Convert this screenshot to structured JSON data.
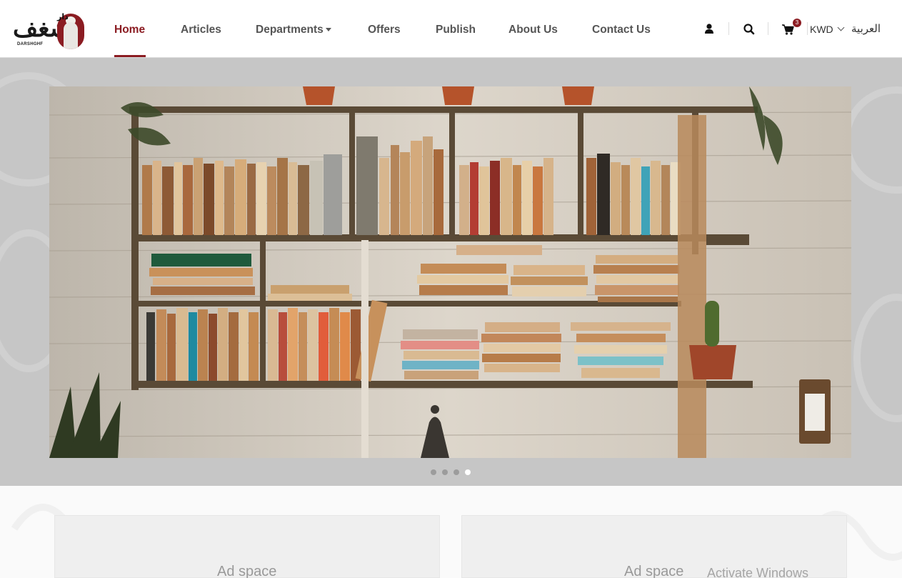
{
  "header": {
    "logo_text": "شغف",
    "logo_small_text": "دار",
    "logo_sub": "DARSHGHF"
  },
  "nav": {
    "items": [
      {
        "label": "Home",
        "active": true
      },
      {
        "label": "Articles"
      },
      {
        "label": "Departments",
        "has_dropdown": true
      },
      {
        "label": "Offers"
      },
      {
        "label": "Publish"
      },
      {
        "label": "About Us"
      },
      {
        "label": "Contact Us"
      }
    ]
  },
  "utilities": {
    "user_icon": "user-icon",
    "search_icon": "search-icon",
    "cart_icon": "cart-icon",
    "cart_count": "3",
    "currency": "KWD",
    "language": "العربية"
  },
  "carousel": {
    "slide_count": 4,
    "active_index": 3
  },
  "ads": {
    "left_label": "Ad space",
    "right_label": "Ad space"
  },
  "os_watermark": "Activate Windows",
  "colors": {
    "accent": "#8b1c22",
    "hero_band": "#c6c6c6",
    "page_bg": "#f7f7f7"
  }
}
